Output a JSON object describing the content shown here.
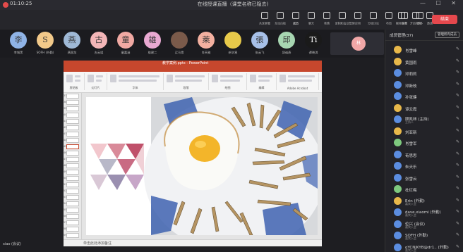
{
  "window": {
    "title": "在线授课直播（课堂名称已隐去)",
    "timer": "01:10:25",
    "controls": "— ☐ ✕"
  },
  "toolbar": {
    "items": [
      {
        "label": "共享屏幕",
        "icon": "share-screen-icon"
      },
      {
        "label": "互动白板",
        "icon": "whiteboard-icon"
      },
      {
        "label": "成员",
        "icon": "members-icon"
      },
      {
        "label": "聊天",
        "icon": "chat-icon"
      },
      {
        "label": "表情",
        "icon": "emoji-icon"
      },
      {
        "label": "录制和会议管理",
        "icon": "record-icon"
      },
      {
        "label": "应用",
        "icon": "apps-icon"
      },
      {
        "label": "分组讨论",
        "icon": "breakout-icon"
      },
      {
        "label": "布局",
        "icon": "layout-icon"
      },
      {
        "label": "设置",
        "icon": "settings-icon"
      },
      {
        "label": "更多",
        "icon": "more-icon"
      }
    ],
    "right_items": [
      {
        "label": "解除静音",
        "icon": "microphone-icon"
      },
      {
        "label": "开启视频",
        "icon": "camera-icon"
      },
      {
        "label": "邀请",
        "icon": "invite-icon"
      }
    ],
    "leave_label": "结束"
  },
  "avatars": [
    {
      "char": "李",
      "name": "李城黑",
      "color": "#8fb3e6"
    },
    {
      "char": "S",
      "name": "SOFH (外勤)",
      "color": "#f2c98a"
    },
    {
      "char": "燕",
      "name": "燕国龙",
      "color": "#9fb9d6"
    },
    {
      "char": "古",
      "name": "古云姐",
      "color": "#f3b6b8"
    },
    {
      "char": "童",
      "name": "童嘉涵",
      "color": "#f0a9a3"
    },
    {
      "char": "雄",
      "name": "雄建二",
      "color": "#e9a9d2"
    },
    {
      "char": "",
      "name": "买马雪",
      "color": "#7a5a4a"
    },
    {
      "char": "萊",
      "name": "肖天雅",
      "color": "#f3b0a0"
    },
    {
      "char": "",
      "name": "新学星",
      "color": "#e7c94a"
    },
    {
      "char": "張",
      "name": "张云飞",
      "color": "#a7c0e8"
    },
    {
      "char": "邱",
      "name": "邱诚燕",
      "color": "#a7d6b1"
    },
    {
      "char": "Ti",
      "name": "谭晓淇",
      "color": "#1a1a1a"
    }
  ],
  "selected_video": {
    "char": "林"
  },
  "ppt": {
    "title": "教学案例.pptx - PowerPoint",
    "tabs": [
      "文件",
      "开始",
      "插入",
      "设计",
      "切换",
      "动画",
      "幻灯片放映",
      "审阅",
      "视图",
      "ACROBAT"
    ],
    "active_tab": "开始",
    "ribbon_groups": [
      "剪贴板",
      "幻灯片",
      "字体",
      "段落",
      "绘图",
      "编辑",
      "Adobe Acrobat"
    ],
    "slide_numbers": [
      "37",
      "38",
      "39",
      "40",
      "41",
      "42",
      "43",
      "44",
      "45",
      "46",
      "47",
      "48",
      "49",
      "50",
      "51",
      "52",
      "53",
      "54",
      "55",
      "56",
      "57",
      "58",
      "59"
    ],
    "selected_slide": "45",
    "status_note": "单击此处添加备注"
  },
  "self_name": "xiao (会议)",
  "panel": {
    "title": "成员管理(37)",
    "action_label": "管理所有成员",
    "participants": [
      {
        "name": "肖雪峰",
        "sub": "",
        "color": "#e8b84a"
      },
      {
        "name": "黄国雨",
        "sub": "",
        "color": "#e8b84a"
      },
      {
        "name": "邓莉莉",
        "sub": "",
        "color": "#5b8de0"
      },
      {
        "name": "邓新枝",
        "sub": "",
        "color": "#5b8de0"
      },
      {
        "name": "孙张健",
        "sub": "",
        "color": "#5b8de0"
      },
      {
        "name": "谭云霞",
        "sub": "",
        "color": "#e8b84a"
      },
      {
        "name": "顾凯林 (主持)",
        "sub": "主持人",
        "color": "#5b8de0"
      },
      {
        "name": "刘亚新",
        "sub": "",
        "color": "#e8b84a"
      },
      {
        "name": "肖雪军",
        "sub": "",
        "color": "#7ec97e"
      },
      {
        "name": "荀思思",
        "sub": "",
        "color": "#5b8de0"
      },
      {
        "name": "朱天乐",
        "sub": "",
        "color": "#5b8de0"
      },
      {
        "name": "张雪云",
        "sub": "",
        "color": "#5b8de0"
      },
      {
        "name": "杜红梅",
        "sub": "",
        "color": "#7ec97e"
      },
      {
        "name": "Erin (外勤)",
        "sub": "嘉宾入会",
        "color": "#e8b84a"
      },
      {
        "name": "dave.xiaomi (外勤)",
        "sub": "嘉宾入会",
        "color": "#5b8de0"
      },
      {
        "name": "伦兴 (会议)",
        "sub": "嘉宾入会",
        "color": "#5b8de0"
      },
      {
        "name": "SOFH (外勤)",
        "sub": "嘉宾入会",
        "color": "#5b8de0"
      },
      {
        "name": "oYCNJKYB@dr1.. (外勤)",
        "sub": "嘉宾入会",
        "color": "#5b8de0"
      }
    ]
  },
  "colors": {
    "ppt_red": "#c6472d",
    "leave_red": "#e5484d",
    "panel_bg": "#232328"
  }
}
